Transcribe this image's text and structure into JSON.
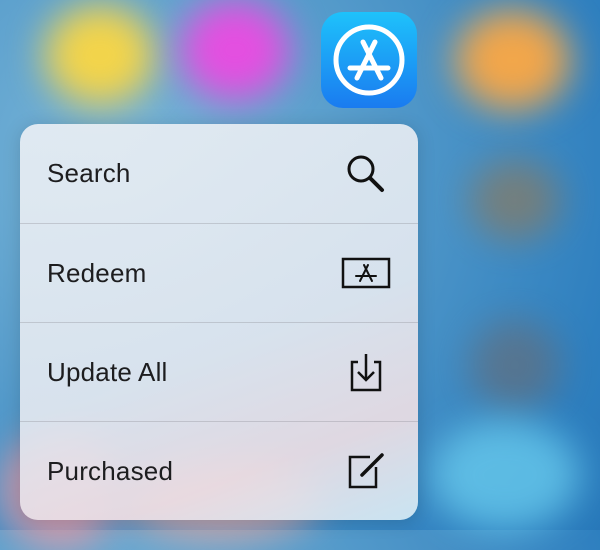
{
  "app": {
    "icon_name": "app-store-icon",
    "accent_color": "#1a8cf5"
  },
  "quick_actions": [
    {
      "label": "Search",
      "icon": "search-icon"
    },
    {
      "label": "Redeem",
      "icon": "redeem-icon"
    },
    {
      "label": "Update All",
      "icon": "download-icon"
    },
    {
      "label": "Purchased",
      "icon": "compose-icon"
    }
  ]
}
